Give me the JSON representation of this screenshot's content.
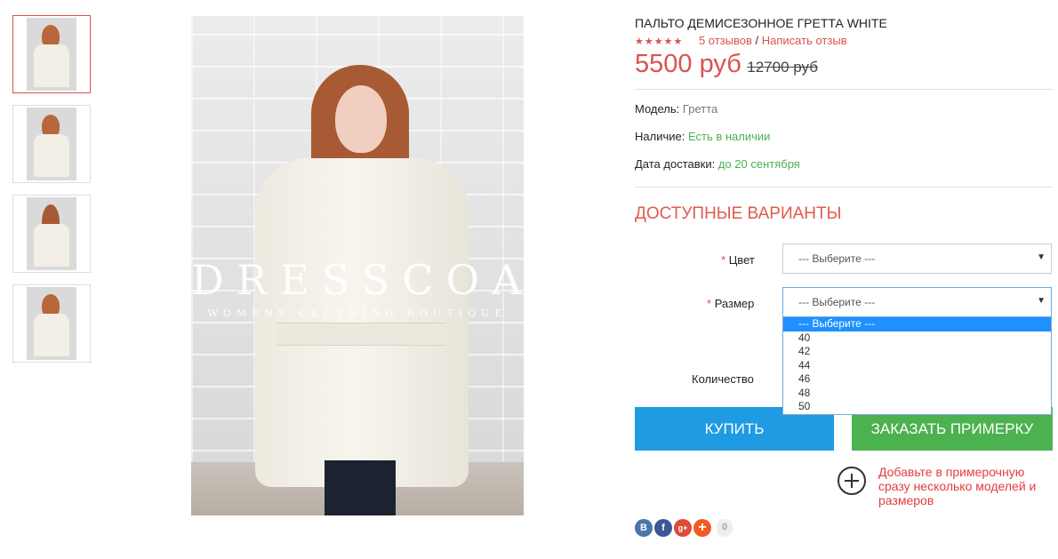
{
  "product": {
    "title": "Пальто демисезонное Гретта WHITE",
    "stars": "★★★★★",
    "reviews_link": "5 отзывов",
    "rating_separator": "/",
    "write_review_link": "Написать отзыв",
    "price": "5500 руб",
    "old_price": "12700 руб"
  },
  "specs": {
    "model_label": "Модель:",
    "model_value": "Гретта",
    "availability_label": "Наличие:",
    "availability_value": "Есть в наличии",
    "delivery_label": "Дата доставки:",
    "delivery_value": "до 20 сентября"
  },
  "gallery": {
    "watermark_title": "DRESSCOAT",
    "watermark_subtitle": "WOMENS CLOTHING BOUTIQUE"
  },
  "options": {
    "section_title": "Доступные варианты",
    "required_mark": "*",
    "color_label": "Цвет",
    "color_value": "--- Выберите ---",
    "size_label": "Размер",
    "size_value": "--- Выберите ---",
    "size_dropdown": [
      "--- Выберите ---",
      "40",
      "42",
      "44",
      "46",
      "48",
      "50"
    ],
    "quantity_label": "Количество",
    "arrow_glyph": "▼"
  },
  "actions": {
    "buy_label": "Купить",
    "fitting_label": "Заказать примерку",
    "add_fitting_text": "Добавьте в примерочную сразу несколько моделей и размеров"
  },
  "share": {
    "vk": "B",
    "fb": "f",
    "gplus": "g+",
    "more": "+",
    "count": "0"
  },
  "colors": {
    "accent_red": "#d9534f",
    "buy_blue": "#1e9be3",
    "fit_green": "#4cb14f",
    "in_stock_green": "#4caf50"
  }
}
